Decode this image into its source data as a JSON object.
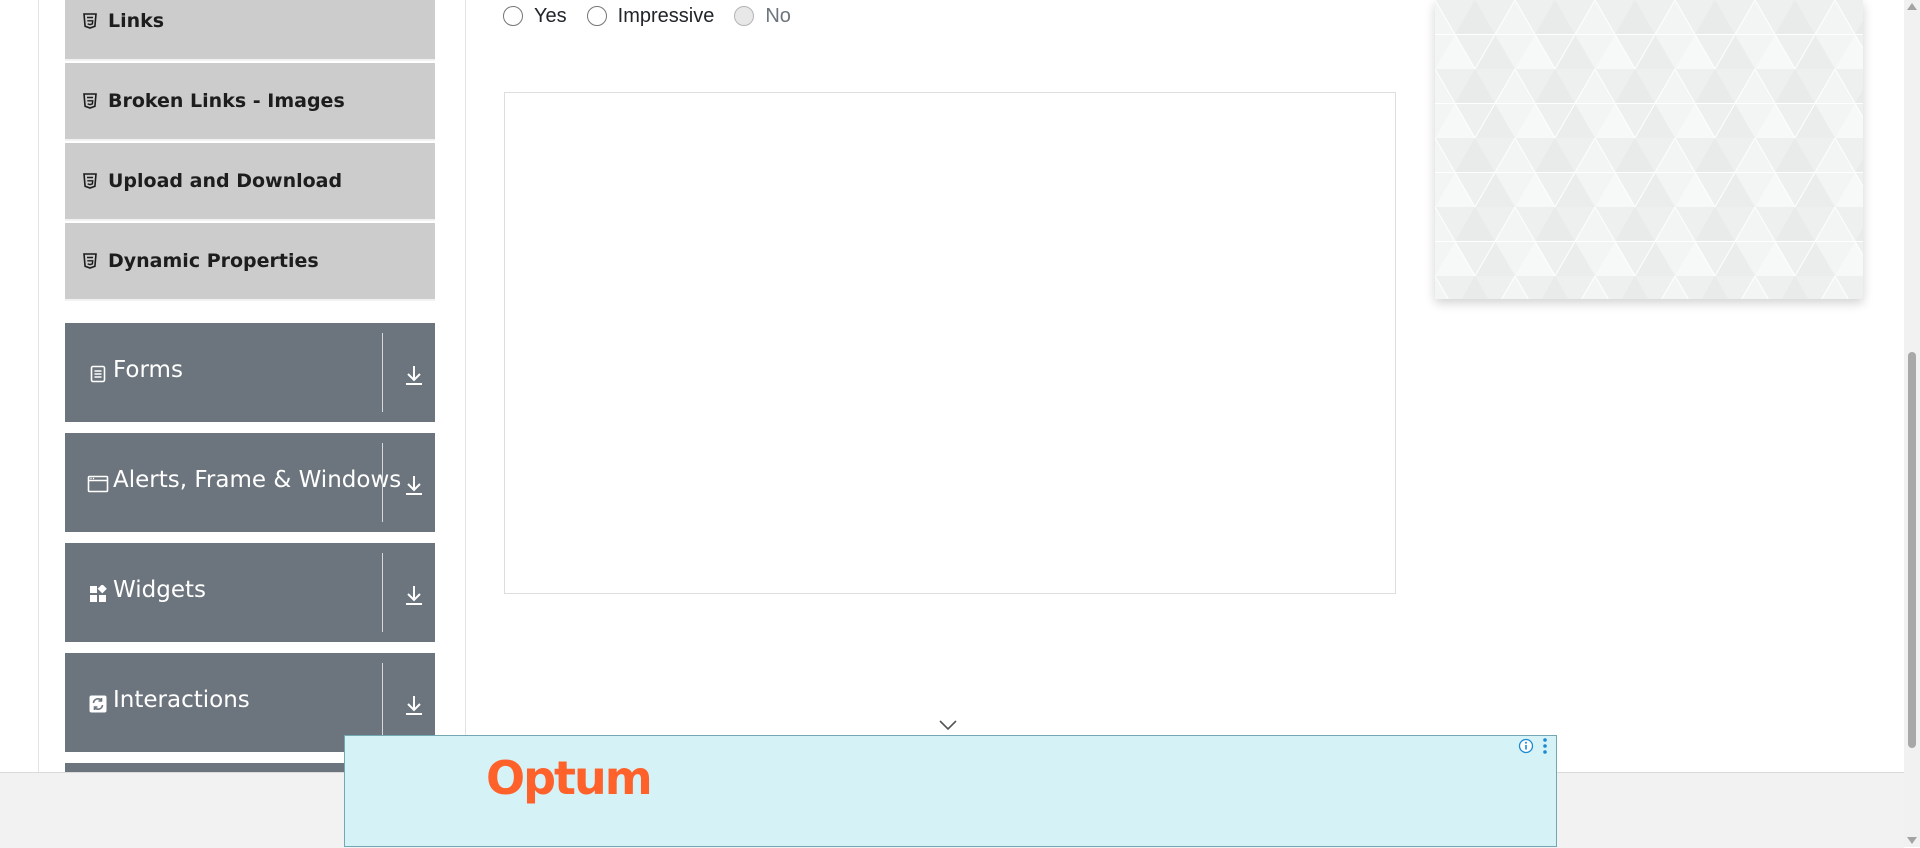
{
  "sidebar": {
    "sub_items": [
      {
        "label": "Links",
        "icon": "html5-icon"
      },
      {
        "label": "Broken Links - Images",
        "icon": "html5-icon"
      },
      {
        "label": "Upload and Download",
        "icon": "html5-icon"
      },
      {
        "label": "Dynamic Properties",
        "icon": "html5-icon"
      }
    ],
    "groups": [
      {
        "label": "Forms",
        "icon": "form-icon",
        "action_icon": "download-arrow-icon"
      },
      {
        "label": "Alerts, Frame & Windows",
        "icon": "window-icon",
        "action_icon": "download-arrow-icon"
      },
      {
        "label": "Widgets",
        "icon": "widgets-icon",
        "action_icon": "download-arrow-icon"
      },
      {
        "label": "Interactions",
        "icon": "interactions-icon",
        "action_icon": "download-arrow-icon"
      }
    ]
  },
  "main": {
    "radio_options": [
      {
        "label": "Yes",
        "checked": false,
        "disabled": false
      },
      {
        "label": "Impressive",
        "checked": false,
        "disabled": false
      },
      {
        "label": "No",
        "checked": false,
        "disabled": true
      }
    ]
  },
  "ad": {
    "brand": "Optum",
    "info_icon": "info-icon",
    "menu_icon": "more-vertical-icon",
    "colors": {
      "background": "#d5f2f7",
      "brand": "#ff612b"
    }
  },
  "colors": {
    "sidebar_group_bg": "#6c757d",
    "sidebar_item_bg": "#cccccc"
  }
}
